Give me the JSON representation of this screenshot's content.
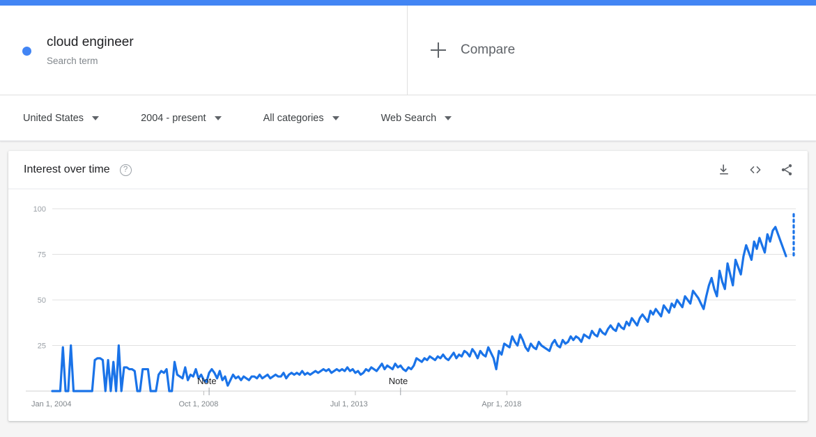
{
  "theme": {
    "accent": "#4285f4",
    "line_color": "#1a73e8",
    "grid_color": "#e0e0e0",
    "page_bg": "#f5f5f5",
    "card_bg": "#ffffff"
  },
  "terms": [
    {
      "name": "cloud engineer",
      "type_label": "Search term",
      "dot_color": "#4285f4"
    }
  ],
  "compare": {
    "label": "Compare",
    "icon": "plus-icon"
  },
  "filters": [
    {
      "name": "location",
      "value": "United States"
    },
    {
      "name": "time-range",
      "value": "2004 - present"
    },
    {
      "name": "category",
      "value": "All categories"
    },
    {
      "name": "search-type",
      "value": "Web Search"
    }
  ],
  "card": {
    "title": "Interest over time",
    "help_icon": "?",
    "actions": [
      {
        "name": "download-icon",
        "label": "Download"
      },
      {
        "name": "embed-icon",
        "label": "Embed"
      },
      {
        "name": "share-icon",
        "label": "Share"
      }
    ]
  },
  "chart_data": {
    "type": "line",
    "title": "Interest over time",
    "xlabel": "",
    "ylabel": "",
    "ylim": [
      0,
      100
    ],
    "yticks": [
      25,
      50,
      75,
      100
    ],
    "grid": true,
    "legend": "none",
    "xticks": [
      {
        "label": "Jan 1, 2004",
        "index": 0
      },
      {
        "label": "Oct 1, 2008",
        "index": 57
      },
      {
        "label": "Jul 1, 2013",
        "index": 114
      },
      {
        "label": "Apr 1, 2018",
        "index": 171
      }
    ],
    "annotations": [
      {
        "label": "Note",
        "index": 59
      },
      {
        "label": "Note",
        "index": 131
      }
    ],
    "partial_tail": {
      "label": "partial data",
      "style": "dotted",
      "from": 97,
      "to": 74
    },
    "series": [
      {
        "name": "cloud engineer",
        "color": "#1a73e8",
        "values": [
          0,
          0,
          0,
          0,
          24,
          0,
          0,
          25,
          0,
          0,
          0,
          0,
          0,
          0,
          0,
          0,
          17,
          18,
          18,
          17,
          0,
          17,
          0,
          16,
          0,
          25,
          0,
          13,
          13,
          12,
          12,
          11,
          0,
          0,
          12,
          12,
          12,
          0,
          0,
          0,
          9,
          11,
          10,
          12,
          0,
          0,
          16,
          9,
          8,
          7,
          13,
          6,
          9,
          8,
          12,
          7,
          9,
          6,
          5,
          10,
          12,
          10,
          7,
          11,
          6,
          8,
          3,
          6,
          9,
          7,
          8,
          6,
          8,
          7,
          6,
          8,
          8,
          7,
          9,
          7,
          8,
          9,
          7,
          8,
          9,
          8,
          8,
          10,
          7,
          9,
          10,
          9,
          10,
          9,
          11,
          9,
          10,
          9,
          10,
          11,
          10,
          11,
          12,
          11,
          12,
          10,
          11,
          12,
          11,
          12,
          11,
          13,
          11,
          12,
          10,
          11,
          9,
          10,
          12,
          11,
          13,
          12,
          11,
          13,
          15,
          12,
          14,
          13,
          12,
          15,
          13,
          14,
          12,
          11,
          13,
          12,
          14,
          18,
          17,
          16,
          18,
          17,
          19,
          18,
          17,
          19,
          18,
          20,
          18,
          17,
          19,
          21,
          18,
          20,
          19,
          22,
          21,
          19,
          23,
          21,
          18,
          22,
          20,
          19,
          24,
          21,
          18,
          12,
          22,
          20,
          26,
          25,
          24,
          30,
          27,
          25,
          31,
          28,
          24,
          22,
          26,
          24,
          23,
          27,
          25,
          24,
          23,
          22,
          26,
          28,
          25,
          24,
          28,
          26,
          27,
          30,
          28,
          30,
          29,
          27,
          31,
          30,
          29,
          33,
          31,
          30,
          34,
          32,
          31,
          34,
          36,
          34,
          33,
          37,
          35,
          34,
          38,
          36,
          40,
          38,
          36,
          40,
          42,
          40,
          38,
          44,
          42,
          45,
          43,
          41,
          47,
          45,
          43,
          48,
          46,
          50,
          48,
          46,
          52,
          50,
          48,
          55,
          53,
          51,
          48,
          45,
          52,
          58,
          62,
          56,
          52,
          66,
          60,
          56,
          70,
          64,
          58,
          72,
          68,
          64,
          74,
          80,
          76,
          72,
          82,
          78,
          84,
          80,
          76,
          86,
          82,
          88,
          90,
          86,
          82,
          78,
          74
        ]
      }
    ]
  }
}
